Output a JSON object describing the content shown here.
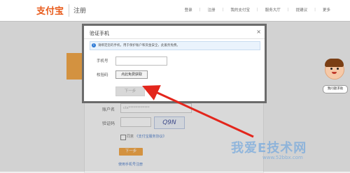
{
  "header": {
    "logo": "支付宝",
    "page_name": "注册",
    "nav": [
      "登录",
      "注册",
      "我的支付宝",
      "服务大厅",
      "提建议",
      "更多"
    ]
  },
  "background_form": {
    "account_label": "账户名",
    "account_value": "ctx************",
    "captcha_label": "验证码",
    "captcha_text": "Q9N",
    "agree_text": "同意",
    "agree_link": "《支付宝服务协议》",
    "next_button": "下一步",
    "mobile_register_link": "使用手机号注册"
  },
  "modal": {
    "title": "验证手机",
    "close": "×",
    "notice": "请绑定您的手机，用于保护账户和资金安全，此服务免费。",
    "phone_label": "手机号",
    "phone_value": "",
    "code_label": "校验码",
    "code_button": "点此免费获取",
    "next_button": "下一步"
  },
  "help": {
    "label": "我问题求助"
  },
  "watermark": {
    "text": "我爱E技术网",
    "url": "www.52bbx.com"
  },
  "colors": {
    "brand": "#e85a1a",
    "accent_orange": "#f29b2e",
    "arrow_red": "#e3261c",
    "link_blue": "#3a6fc4"
  }
}
